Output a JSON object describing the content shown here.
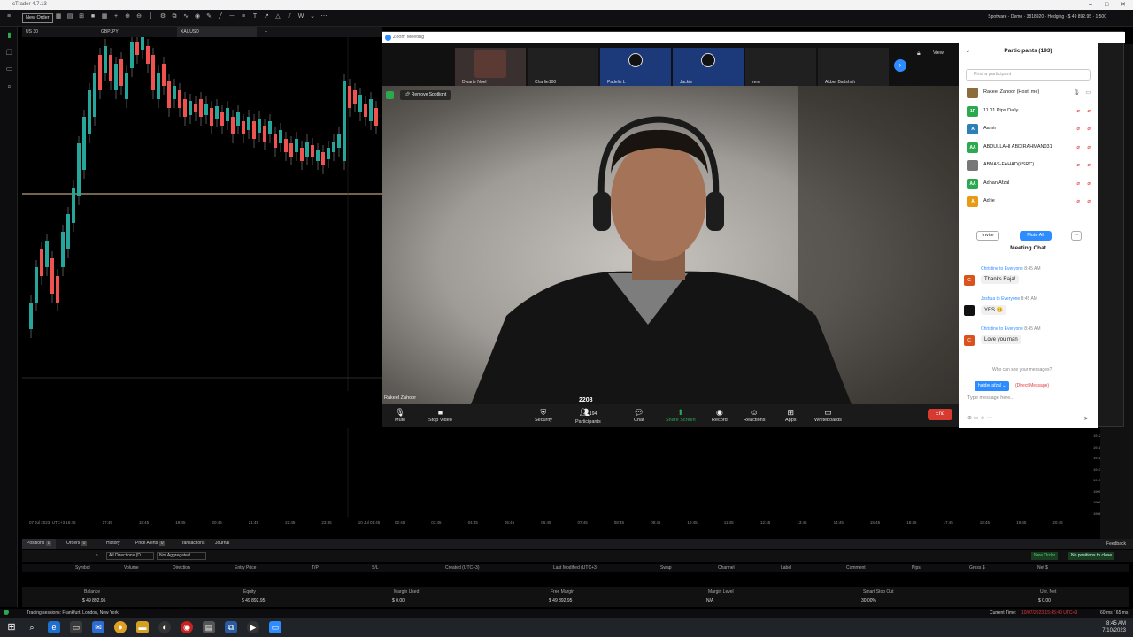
{
  "app": {
    "title": "cTrader 4.7.13"
  },
  "toolbar": {
    "new_order": "New Order",
    "account": "Spotware · Demo · 3818920 · Hedging · $ 49 892.95 · 1:500"
  },
  "chart_tabs": [
    {
      "label": "US 30"
    },
    {
      "label": "GBPJPY"
    },
    {
      "label": "XAUUSD"
    }
  ],
  "chart": {
    "x_ticks": [
      "07 Jul 2023, UTC+3",
      "16:45",
      "17:45",
      "18:45",
      "19:45",
      "20:45",
      "21:45",
      "22:45",
      "23:45",
      "10 Jul 01:45",
      "02:45",
      "03:45",
      "04:45",
      "05:45",
      "06:45",
      "07:45",
      "08:45",
      "09:45",
      "10:45",
      "11:45",
      "12:45",
      "13:45",
      "14:45",
      "15:45",
      "16:45",
      "17:45",
      "18:45",
      "19:45",
      "20:45"
    ],
    "price_ticks": [
      "1912.00",
      "1911.50",
      "1911.00",
      "1910.50",
      "1910.00",
      "1909.50",
      "1909.00",
      "1908.50"
    ]
  },
  "zoom": {
    "window_title": "Zoom Meeting",
    "view_label": "View",
    "thumbnails": [
      {
        "name": "Dwarte Noel"
      },
      {
        "name": "Charlie100"
      },
      {
        "name": "Padelis L"
      },
      {
        "name": "Jackie"
      },
      {
        "name": "rem"
      },
      {
        "name": "Akber Badshah"
      }
    ],
    "spotlight_label": "Remove Spotlight",
    "speaker_name": "Rakeel Zahoor",
    "participant_count": "194",
    "badge_text": "2208",
    "controls": {
      "mute": "Mute",
      "stop_video": "Stop Video",
      "security": "Security",
      "participants": "Participants",
      "chat": "Chat",
      "share_screen": "Share Screen",
      "record": "Record",
      "reactions": "Reactions",
      "apps": "Apps",
      "whiteboards": "Whiteboards",
      "end": "End"
    },
    "participants_panel": {
      "title": "Participants (193)",
      "search_placeholder": "Find a participant",
      "people": [
        {
          "initials": "",
          "name": "Rakeel Zahoor (Host, me)",
          "color": "#8a6d3b"
        },
        {
          "initials": "1P",
          "name": "11.01 Pips Daily",
          "color": "#2ca84e"
        },
        {
          "initials": "A",
          "name": "Aamir",
          "color": "#2d7fb8"
        },
        {
          "initials": "AA",
          "name": "ABDULLAHI ABDIRAHMAN031",
          "color": "#2ca84e"
        },
        {
          "initials": "",
          "name": "ABNAS-FAHAD(#SRC)",
          "color": "#777777"
        },
        {
          "initials": "AA",
          "name": "Adnan Afzal",
          "color": "#2ca84e"
        },
        {
          "initials": "A",
          "name": "Adrie",
          "color": "#e69a16"
        }
      ],
      "invite": "Invite",
      "mute_all": "Mute All",
      "more": "···"
    },
    "chat": {
      "title": "Meeting Chat",
      "messages": [
        {
          "from": "Christine to Everyone",
          "time": "8:45 AM",
          "text": "Thanks Raja!",
          "initial": "C",
          "color": "#d9531e"
        },
        {
          "from": "Joshua to Everyone",
          "time": "8:45 AM",
          "text": "YES 😀",
          "initial": "",
          "color": "#111111"
        },
        {
          "from": "Christine to Everyone",
          "time": "8:45 AM",
          "text": "Love you man",
          "initial": "C",
          "color": "#d9531e"
        }
      ],
      "who_can_see": "Who can see your messages?",
      "to": "haider afzal ⌄",
      "direct": "(Direct Message)",
      "input_placeholder": "Type message here..."
    }
  },
  "bottom": {
    "tabs": [
      {
        "label": "Positions",
        "count": "0"
      },
      {
        "label": "Orders",
        "count": "0"
      },
      {
        "label": "History",
        "count": ""
      },
      {
        "label": "Price Alerts",
        "count": "0"
      },
      {
        "label": "Transactions",
        "count": ""
      },
      {
        "label": "Journal",
        "count": ""
      }
    ],
    "feedback": "Feedback",
    "filter_directions": "All Directions (D",
    "filter_aggregated": "Not Aggregated",
    "new_order": "New Order",
    "no_positions": "No positions to close",
    "columns": [
      "Symbol",
      "Volume",
      "Direction",
      "Entry Price",
      "T/P",
      "S/L",
      "Created (UTC+3)",
      "Last Modified (UTC+3)",
      "Swap",
      "Channel",
      "Label",
      "Comment",
      "Pips",
      "Gross $",
      "Net $"
    ],
    "summary_labels": [
      "Balance",
      "Equity",
      "Margin Used",
      "Free Margin",
      "Margin Level",
      "Smart Stop Out",
      "Unr. Net"
    ],
    "summary_values": [
      "$ 49 892.95",
      "$ 49 892.95",
      "$ 0.00",
      "$ 49 892.95",
      "N/A",
      "30.00%",
      "$ 0.00"
    ]
  },
  "status": {
    "sessions": "Trading sessions: Frankfurt, London, New York",
    "current_time_label": "Current Time:",
    "current_time": "10/07/2023 15:45:40  UTC+3",
    "latency": "60 ms / 65 ms"
  },
  "clock": {
    "time": "8:45 AM",
    "date": "7/10/2023"
  }
}
